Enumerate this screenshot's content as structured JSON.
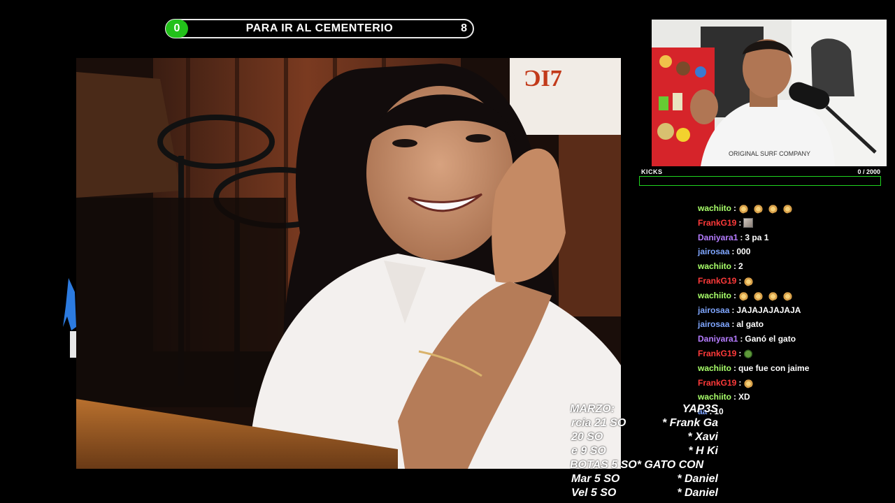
{
  "goal": {
    "count": "0",
    "title": "PARA IR AL CEMENTERIO",
    "target": "8"
  },
  "kicks": {
    "label": "KICKS",
    "count": "0 / 2000",
    "progress_fraction": 0,
    "bar_color": "#1fd41f"
  },
  "colors": {
    "goal_green": "#22c11a",
    "user_green": "#a8ff6a",
    "user_red": "#ff3a3a",
    "user_purple": "#b57cff",
    "user_blue": "#7fa6ff"
  },
  "chat": [
    {
      "user": "wachiito",
      "color": "#a8ff6a",
      "msg": "",
      "emotes": [
        "fire",
        "fire",
        "fire",
        "fire"
      ]
    },
    {
      "user": "FrankG19",
      "color": "#ff3a3a",
      "msg": "",
      "emotes": [
        "img"
      ]
    },
    {
      "user": "Daniyara1",
      "color": "#b57cff",
      "msg": "3 pa 1",
      "emotes": []
    },
    {
      "user": "jairosaa",
      "color": "#7fa6ff",
      "msg": "000",
      "emotes": []
    },
    {
      "user": "wachiito",
      "color": "#a8ff6a",
      "msg": "2",
      "emotes": []
    },
    {
      "user": "FrankG19",
      "color": "#ff3a3a",
      "msg": "",
      "emotes": [
        "fire"
      ]
    },
    {
      "user": "wachiito",
      "color": "#a8ff6a",
      "msg": "",
      "emotes": [
        "fire",
        "fire",
        "fire",
        "fire"
      ]
    },
    {
      "user": "jairosaa",
      "color": "#7fa6ff",
      "msg": "JAJAJAJAJAJA",
      "emotes": []
    },
    {
      "user": "jairosaa",
      "color": "#7fa6ff",
      "msg": "al gato",
      "emotes": []
    },
    {
      "user": "Daniyara1",
      "color": "#b57cff",
      "msg": "Ganó el gato",
      "emotes": []
    },
    {
      "user": "FrankG19",
      "color": "#ff3a3a",
      "msg": "",
      "emotes": [
        "frog"
      ]
    },
    {
      "user": "wachiito",
      "color": "#a8ff6a",
      "msg": "que fue con jaime",
      "emotes": []
    },
    {
      "user": "FrankG19",
      "color": "#ff3a3a",
      "msg": "",
      "emotes": [
        "fire"
      ]
    },
    {
      "user": "wachiito",
      "color": "#a8ff6a",
      "msg": "XD",
      "emotes": []
    },
    {
      "user": "aa",
      "color": "#7fa6ff",
      "msg": "10",
      "emotes": []
    }
  ],
  "credits": [
    {
      "text": "MARZO:",
      "col": "left"
    },
    {
      "text": "YAP3S",
      "col": "right"
    },
    {
      "text": "rcia 21 SO",
      "col": "left"
    },
    {
      "text": "* Frank Ga",
      "col": "right"
    },
    {
      "text": "20 SO",
      "col": "left"
    },
    {
      "text": "* Xavi",
      "col": "right"
    },
    {
      "text": "e 9 SO",
      "col": "left"
    },
    {
      "text": "* H Ki",
      "col": "right"
    },
    {
      "text": "BOTAS 5 SO* GATO CON",
      "col": "full"
    },
    {
      "text": "Mar 5 SO",
      "col": "left"
    },
    {
      "text": "* Daniel",
      "col": "right"
    },
    {
      "text": "Vel 5 SO",
      "col": "left"
    },
    {
      "text": "* Daniel",
      "col": "right"
    }
  ]
}
